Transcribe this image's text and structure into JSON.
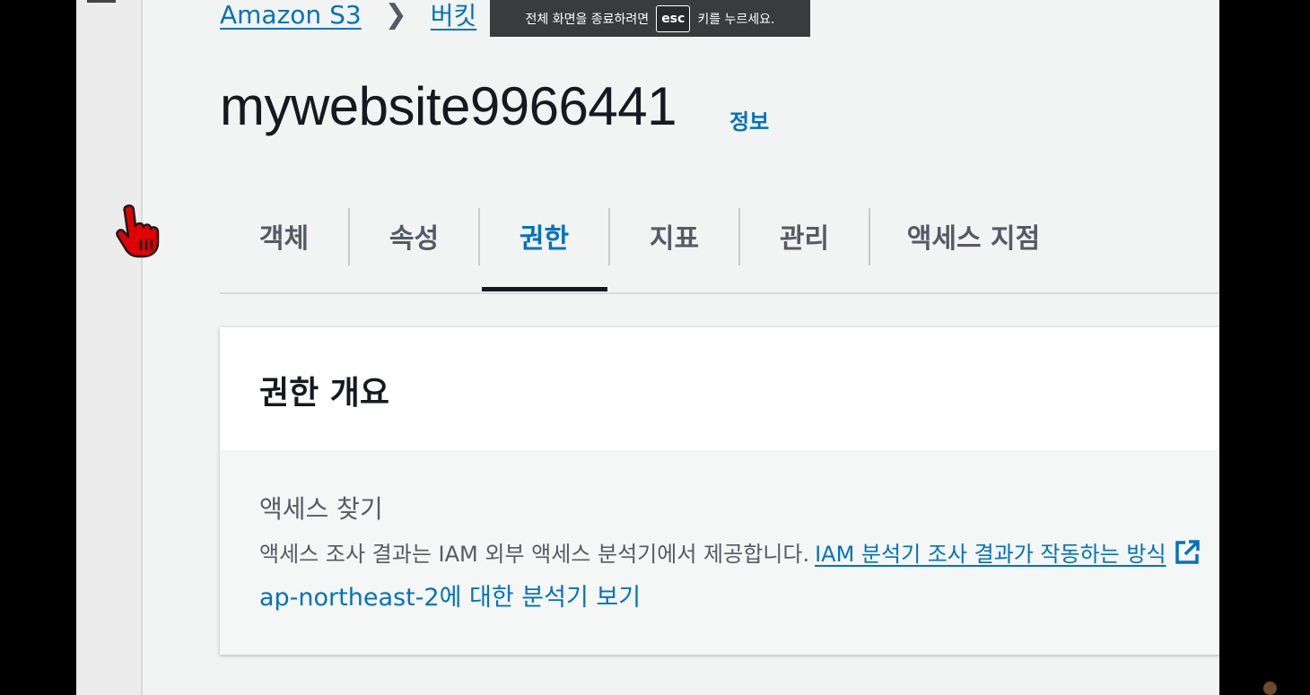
{
  "breadcrumb": {
    "root": "Amazon S3",
    "buckets": "버킷"
  },
  "fullscreen_banner": {
    "before": "전체 화면을 종료하려면",
    "key": "esc",
    "after": "키를 누르세요."
  },
  "page": {
    "title": "mywebsite9966441",
    "info": "정보"
  },
  "tabs": [
    {
      "label": "객체"
    },
    {
      "label": "속성"
    },
    {
      "label": "권한",
      "active": true
    },
    {
      "label": "지표"
    },
    {
      "label": "관리"
    },
    {
      "label": "액세스 지점"
    }
  ],
  "panel": {
    "title": "권한 개요",
    "section_label": "액세스 찾기",
    "description": "액세스 조사 결과는 IAM 외부 액세스 분석기에서 제공합니다.",
    "learn_link": "IAM 분석기 조사 결과가 작동하는 방식",
    "region_link": "ap-northeast-2에 대한 분석기 보기"
  },
  "colors": {
    "link": "#0073bb",
    "text": "#16191f",
    "muted": "#545b64",
    "cursor": "#e00000"
  },
  "icons": [
    "pointer-hand-icon",
    "external-link-icon",
    "chevron-right-icon"
  ]
}
